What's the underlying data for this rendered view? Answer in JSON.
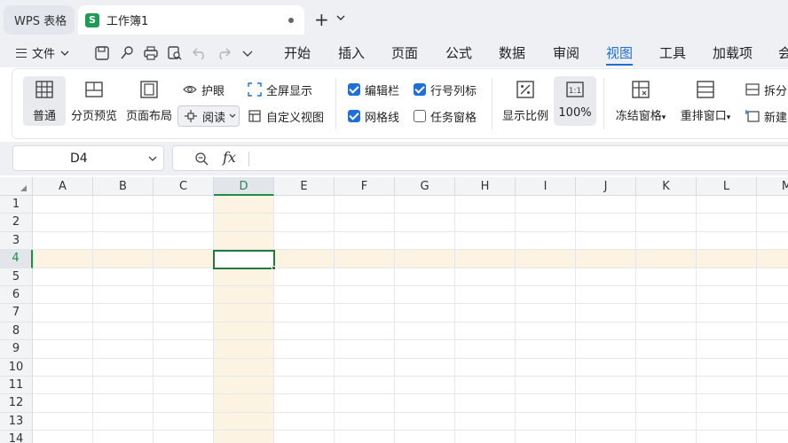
{
  "tabs": {
    "wps_label": "WPS 表格",
    "doc_badge": "S",
    "doc_title": "工作簿1",
    "new_tab": "+"
  },
  "menu": {
    "file_label": "文件",
    "items": [
      "开始",
      "插入",
      "页面",
      "公式",
      "数据",
      "审阅",
      "视图",
      "工具",
      "加载项",
      "会"
    ],
    "active_item": "视图",
    "accent_color": "#1f6fd9"
  },
  "ribbon": {
    "normal": "普通",
    "page_break_preview": "分页预览",
    "page_layout": "页面布局",
    "eye_protect": "护眼",
    "read_mode": "阅读",
    "fullscreen": "全屏显示",
    "custom_view": "自定义视图",
    "edit_bar": "编辑栏",
    "gridlines": "网格线",
    "row_col_headers": "行号列标",
    "task_pane": "任务窗格",
    "zoom_ratio": "显示比例",
    "zoom_100": "100%",
    "freeze_panes": "冻结窗格",
    "rearrange_windows": "重排窗口",
    "split": "拆分",
    "new_window": "新建",
    "checkboxes": {
      "edit_bar": true,
      "row_col_headers": true,
      "gridlines": true,
      "task_pane": false
    }
  },
  "formula_bar": {
    "name_box": "D4",
    "fx": "fx",
    "formula": ""
  },
  "grid": {
    "columns": [
      "A",
      "B",
      "C",
      "D",
      "E",
      "F",
      "G",
      "H",
      "I",
      "J",
      "K",
      "L",
      "M"
    ],
    "rows": [
      "1",
      "2",
      "3",
      "4",
      "5",
      "6",
      "7",
      "8",
      "9",
      "10",
      "11",
      "12",
      "13",
      "14"
    ],
    "active_cell": "D4",
    "selection_color": "#1f7a3c",
    "highlight_color": "#fcf3e3"
  }
}
